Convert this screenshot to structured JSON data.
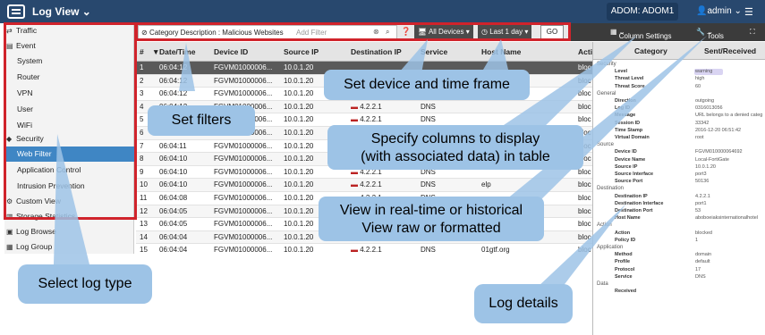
{
  "topbar": {
    "title": "Log View",
    "adom": "ADOM: ADOM1",
    "user": "admin",
    "menu_icon": "hamburger-icon"
  },
  "nav": {
    "items": [
      {
        "label": "Traffic",
        "icon": "traffic-icon"
      },
      {
        "label": "Event",
        "icon": "event-icon"
      },
      {
        "label": "System"
      },
      {
        "label": "Router"
      },
      {
        "label": "VPN"
      },
      {
        "label": "User"
      },
      {
        "label": "WiFi"
      },
      {
        "label": "Security",
        "icon": "shield-icon"
      },
      {
        "label": "Web Filter"
      },
      {
        "label": "Application Control"
      },
      {
        "label": "Intrusion Prevention"
      },
      {
        "label": "Custom View",
        "icon": "custom-view-icon"
      },
      {
        "label": "Storage Statistics",
        "icon": "storage-icon"
      },
      {
        "label": "Log Browse",
        "icon": "log-browse-icon"
      },
      {
        "label": "Log Group",
        "icon": "log-group-icon"
      }
    ]
  },
  "filter": {
    "tag": "Category Description : Malicious Websites",
    "placeholder": "Add Filter",
    "devices": "All Devices",
    "time": "Last 1 day",
    "go": "GO"
  },
  "toolbar": {
    "column_settings": "Column Settings",
    "tools": "Tools"
  },
  "table": {
    "headers": [
      "#",
      "Date/Time",
      "Device ID",
      "Source IP",
      "Destination IP",
      "Service",
      "Host Name",
      "Action"
    ],
    "rows": [
      [
        "1",
        "06:04:12",
        "FGVM01000006...",
        "10.0.1.20",
        "",
        "",
        "",
        "bloc"
      ],
      [
        "2",
        "06:04:12",
        "FGVM01000006...",
        "10.0.1.20",
        "",
        "",
        "",
        "bloc"
      ],
      [
        "3",
        "06:04:12",
        "FGVM01000006...",
        "10.0.1.20",
        "",
        "",
        "",
        "bloc"
      ],
      [
        "4",
        "06:04:12",
        "FGVM01000006...",
        "10.0.1.20",
        "4.2.2.1",
        "DNS",
        "",
        "bloc"
      ],
      [
        "5",
        "06:04:12",
        "FGVM01000006...",
        "10.0.1.20",
        "4.2.2.1",
        "DNS",
        "",
        "bloc"
      ],
      [
        "6",
        "06:04:12",
        "FGVM01000006...",
        "10.0.1.20",
        "4.2.2.1",
        "DNS",
        "",
        "bloc"
      ],
      [
        "7",
        "06:04:11",
        "FGVM01000006...",
        "10.0.1.20",
        "4.2.2.1",
        "DNS",
        "569-",
        "bloc"
      ],
      [
        "8",
        "06:04:10",
        "FGVM01000006...",
        "10.0.1.20",
        "4.2.2.1",
        "DNS",
        "se.569-",
        "bloc"
      ],
      [
        "9",
        "06:04:10",
        "FGVM01000006...",
        "10.0.1.20",
        "4.2.2.1",
        "DNS",
        "",
        "bloc"
      ],
      [
        "10",
        "06:04:10",
        "FGVM01000006...",
        "10.0.1.20",
        "4.2.2.1",
        "DNS",
        "elp",
        "bloc"
      ],
      [
        "11",
        "06:04:08",
        "FGVM01000006...",
        "10.0.1.20",
        "4.2.2.1",
        "DNS",
        "",
        "bloc"
      ],
      [
        "12",
        "06:04:05",
        "FGVM01000006...",
        "10.0.1.20",
        "4.2.2.1",
        "DNS",
        "",
        "bloc"
      ],
      [
        "13",
        "06:04:05",
        "FGVM01000006...",
        "10.0.1.20",
        "4.2.2.1",
        "DNS",
        "",
        "bloc"
      ],
      [
        "14",
        "06:04:04",
        "FGVM01000006...",
        "10.0.1.20",
        "4.2.2.1",
        "DNS",
        "",
        "bloc"
      ],
      [
        "15",
        "06:04:04",
        "FGVM01000006...",
        "10.0.1.20",
        "4.2.2.1",
        "DNS",
        "01gtf.org",
        "bloc"
      ]
    ]
  },
  "details": {
    "headers": [
      "Category",
      "Sent/Received"
    ],
    "lines": [
      {
        "t": "sec",
        "k": "Security"
      },
      {
        "t": "kv",
        "k": "Level",
        "v": "warning"
      },
      {
        "t": "kv",
        "k": "Threat Level",
        "v": "high"
      },
      {
        "t": "kv",
        "k": "Threat Score",
        "v": "60"
      },
      {
        "t": "sec",
        "k": "General"
      },
      {
        "t": "kv",
        "k": "Direction",
        "v": "outgoing"
      },
      {
        "t": "kv",
        "k": "Log ID",
        "v": "0316013056"
      },
      {
        "t": "kv",
        "k": "Message",
        "v": "URL belongs to a denied categ"
      },
      {
        "t": "kv",
        "k": "Session ID",
        "v": "33342"
      },
      {
        "t": "kv",
        "k": "Time Stamp",
        "v": "2016-12-20 06:51:42"
      },
      {
        "t": "kv",
        "k": "Virtual Domain",
        "v": "root"
      },
      {
        "t": "sec",
        "k": "Source"
      },
      {
        "t": "kv",
        "k": "Device ID",
        "v": "FGVM010000064692"
      },
      {
        "t": "kv",
        "k": "Device Name",
        "v": "Local-FortiGate"
      },
      {
        "t": "kv",
        "k": "Source IP",
        "v": "10.0.1.20"
      },
      {
        "t": "kv",
        "k": "Source Interface",
        "v": "port3"
      },
      {
        "t": "kv",
        "k": "Source Port",
        "v": "50136"
      },
      {
        "t": "sec",
        "k": "Destination"
      },
      {
        "t": "kv",
        "k": "Destination IP",
        "v": "4.2.2.1"
      },
      {
        "t": "kv",
        "k": "Destination Interface",
        "v": "port1"
      },
      {
        "t": "kv",
        "k": "Destination Port",
        "v": "53"
      },
      {
        "t": "kv",
        "k": "Host Name",
        "v": "aboboeiaksinternationalhotel"
      },
      {
        "t": "sec",
        "k": "Action"
      },
      {
        "t": "kv",
        "k": "Action",
        "v": "blocked"
      },
      {
        "t": "kv",
        "k": "Policy ID",
        "v": "1"
      },
      {
        "t": "sec",
        "k": "Application"
      },
      {
        "t": "kv",
        "k": "Method",
        "v": "domain"
      },
      {
        "t": "kv",
        "k": "Profile",
        "v": "default"
      },
      {
        "t": "kv",
        "k": "Protocol",
        "v": "17"
      },
      {
        "t": "kv",
        "k": "Service",
        "v": "DNS"
      },
      {
        "t": "sec",
        "k": "Data"
      },
      {
        "t": "kv",
        "k": "Received",
        "v": ""
      }
    ]
  },
  "callouts": {
    "set_filters": "Set filters",
    "device_time": "Set device and time frame",
    "columns_1": "Specify columns to display",
    "columns_2": "(with associated data) in table",
    "view_1": "View in real-time or historical",
    "view_2": "View raw or formatted",
    "log_type": "Select log type",
    "log_details": "Log details"
  },
  "colors": {
    "header": "#28486e",
    "highlight": "#d0232b",
    "callout": "#9dc3e6",
    "selected": "#3f86c4"
  }
}
